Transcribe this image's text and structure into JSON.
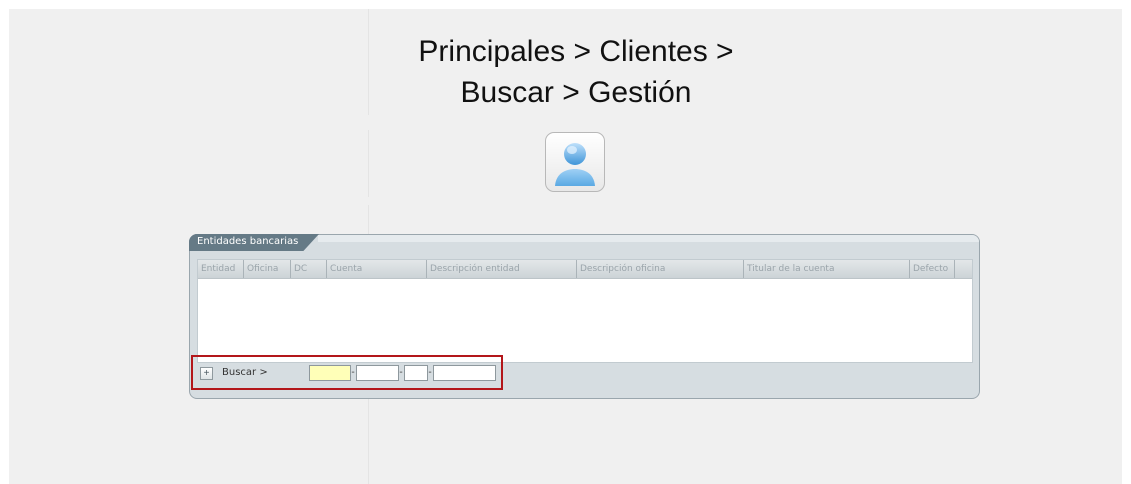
{
  "breadcrumb": {
    "line1": "Principales > Clientes >",
    "line2": "Buscar > Gestión"
  },
  "client_button": {
    "icon": "user-avatar-icon"
  },
  "panel": {
    "title": "Entidades bancarias",
    "columns": [
      "Entidad",
      "Oficina",
      "DC",
      "Cuenta",
      "Descripción entidad",
      "Descripción oficina",
      "Titular de la cuenta",
      "Defecto"
    ],
    "rows": [],
    "footer": {
      "add_icon": "plus-icon",
      "add_symbol": "+",
      "search_label": "Buscar >",
      "separator": "-",
      "fields": [
        {
          "name": "entidad",
          "value": ""
        },
        {
          "name": "oficina",
          "value": ""
        },
        {
          "name": "dc",
          "value": ""
        },
        {
          "name": "cuenta",
          "value": ""
        }
      ]
    }
  },
  "colors": {
    "panel_bg": "#d6dde1",
    "tab_bg": "#657a86",
    "active_field": "#ffffb8",
    "highlight": "#b3161a"
  }
}
